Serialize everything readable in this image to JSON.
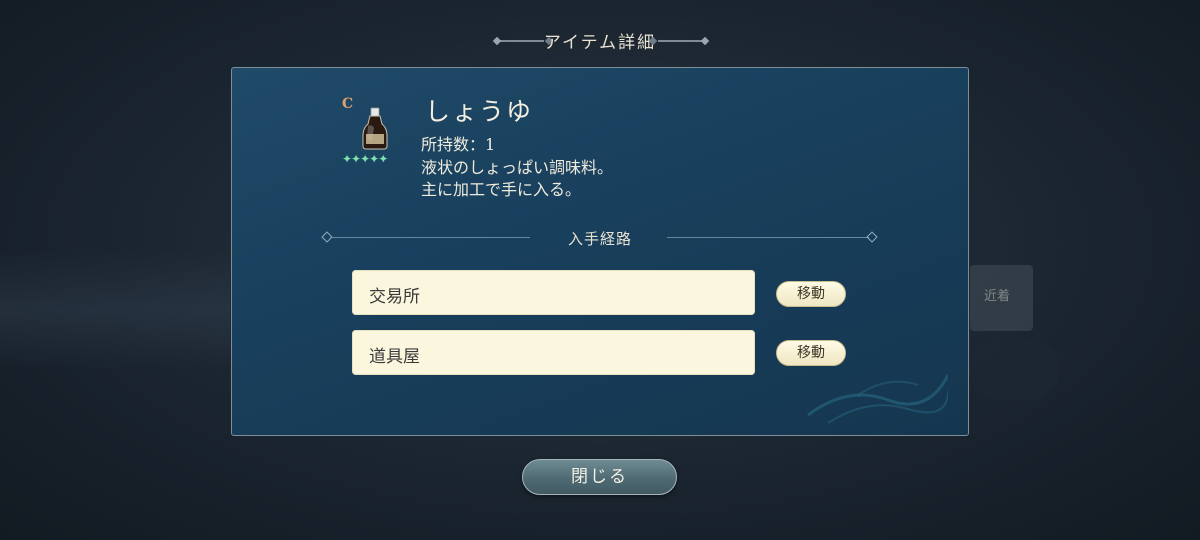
{
  "dialog": {
    "title": "アイテム詳細"
  },
  "item": {
    "rarity_mark": "C",
    "name": "しょうゆ",
    "count_label": "所持数：1",
    "description_line1": "液状のしょっぱい調味料。",
    "description_line2": "主に加工で手に入る。",
    "stars": "✦✦✦✦✦",
    "icon": "soy-sauce-bottle-icon"
  },
  "acquisition": {
    "header": "入手経路",
    "routes": [
      {
        "label": "交易所",
        "button": "移動"
      },
      {
        "label": "道具屋",
        "button": "移動"
      }
    ]
  },
  "background": {
    "blurred_button": "近着"
  },
  "footer": {
    "close_label": "閉じる"
  },
  "colors": {
    "panel": "#1b4362",
    "field": "#fbf7de",
    "close_button": "#5a757e",
    "stars": "#7fe0b0"
  }
}
